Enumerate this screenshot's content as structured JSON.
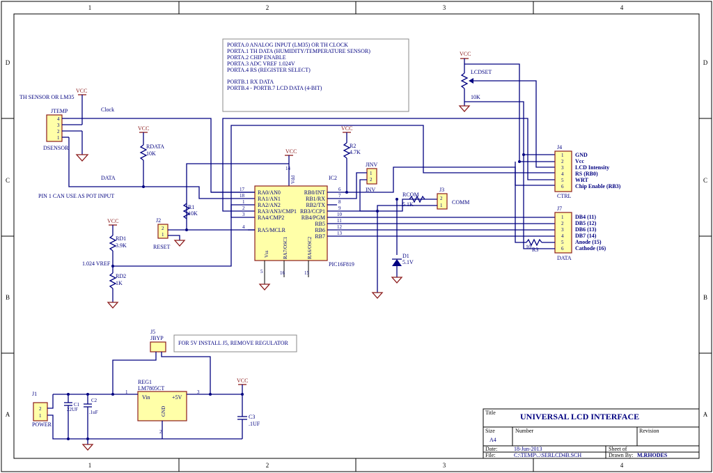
{
  "frame": {
    "columns": [
      "1",
      "2",
      "3",
      "4"
    ],
    "rows": [
      "D",
      "C",
      "B",
      "A"
    ]
  },
  "notes": {
    "porta": [
      "PORTA.0 ANALOG INPUT (LM35) OR TH CLOCK",
      "PORTA.1 TH DATA (HUMIDITY/TEMPERATURE SENSOR)",
      "PORTA.2 CHIP ENABLE",
      "PORTA.3 ADC VREF 1.024V",
      "PORTA.4 RS (REGISTER SELECT)"
    ],
    "portb": [
      "PORTB.1 RX DATA",
      "PORTB.4 - PORTB.7  LCD DATA (4-BIT)"
    ],
    "j5_note": "FOR 5V INSTALL J5, REMOVE REGULATOR",
    "pin1_note": "PIN 1 CAN USE AS POT INPUT"
  },
  "power_labels": {
    "vcc": "VCC"
  },
  "net_labels": {
    "clock": "Clock",
    "data": "DATA",
    "vref": "1.024 VREF"
  },
  "components": {
    "jtemp": {
      "ref": "JTEMP",
      "name": "DSENSOR",
      "header": "TH SENSOR OR LM35",
      "pins": [
        "4",
        "3",
        "2",
        "1"
      ]
    },
    "rdata": {
      "ref": "RDATA",
      "value": "10K"
    },
    "r1": {
      "ref": "R1",
      "value": "10K"
    },
    "r2": {
      "ref": "R2",
      "value": "4.7K"
    },
    "rd1": {
      "ref": "RD1",
      "value": "3.9K"
    },
    "rd2": {
      "ref": "RD2",
      "value": "1K"
    },
    "r3": {
      "ref": "R3",
      "value": "10"
    },
    "rcom": {
      "ref": "RCOM",
      "value": "5.1K"
    },
    "lcdset": {
      "ref": "LCDSET",
      "value": "10K"
    },
    "j2": {
      "ref": "J2",
      "name": "RESET",
      "pins": [
        "2",
        "1"
      ]
    },
    "jinv": {
      "ref": "JINV",
      "name": "INV",
      "pins": [
        "1",
        "2"
      ]
    },
    "j3": {
      "ref": "J3",
      "name": "COMM",
      "pins": [
        "2",
        "1"
      ]
    },
    "d1": {
      "ref": "D1",
      "value": "5.1V"
    },
    "j4": {
      "ref": "J4",
      "name": "CTRL",
      "pins": [
        "1",
        "2",
        "3",
        "4",
        "5",
        "6"
      ],
      "labels": [
        "GND",
        "Vcc",
        "LCD Intensity",
        "RS (RB0)",
        "WRT",
        "Chip Enable (RB3)"
      ]
    },
    "j7": {
      "ref": "J7",
      "name": "DATA",
      "pins": [
        "1",
        "2",
        "3",
        "4",
        "5",
        "6"
      ],
      "labels": [
        "DB4 (11)",
        "DB5 (12)",
        "DB6 (13)",
        "DB7 (14)",
        "Anode (15)",
        "Cathode (16)"
      ]
    },
    "ic2": {
      "ref": "IC2",
      "name": "PIC16F819",
      "left_pins": [
        "RA0/AN0",
        "RA1/AN1",
        "RA2/AN2",
        "RA3/AN3/CMP1",
        "RA4/CMP2",
        "RA5/MCLR"
      ],
      "left_nums": [
        "17",
        "18",
        "1",
        "2",
        "3",
        "4"
      ],
      "right_pins": [
        "RB0/INT",
        "RB1/RX",
        "RB2/TX",
        "RB3/CCP1",
        "RB4/PGM",
        "RB5",
        "RB6",
        "RB7"
      ],
      "right_nums": [
        "6",
        "7",
        "8",
        "9",
        "10",
        "11",
        "12",
        "13"
      ],
      "vdd": "Vdd",
      "vdd_num": "14",
      "vss": "Vss",
      "vss_num": "5",
      "osc1": "RA7/OSC1",
      "osc1_num": "16",
      "osc2": "RA6/OSC2",
      "osc2_num": "15"
    },
    "j5": {
      "ref": "J5",
      "name": "JBYP"
    },
    "reg1": {
      "ref": "REG1",
      "name": "LM7805CT",
      "vin": "Vin",
      "vout": "+5V",
      "gnd": "GND",
      "pin_in": "1",
      "pin_out": "3",
      "pin_gnd": "2"
    },
    "j1": {
      "ref": "J1",
      "name": "POWER",
      "pins": [
        "2",
        "1"
      ]
    },
    "c1": {
      "ref": "C1",
      "value": "22UF"
    },
    "c2": {
      "ref": "C2",
      "value": ".1uF"
    },
    "c3": {
      "ref": "C3",
      "value": ".1UF"
    }
  },
  "title_block": {
    "title_label": "Title",
    "title": "UNIVERSAL LCD INTERFACE",
    "size_label": "Size",
    "size": "A4",
    "number_label": "Number",
    "revision_label": "Revision",
    "date_label": "Date:",
    "date": "18-Jun-2013",
    "sheet_label": "Sheet    of",
    "file_label": "File:",
    "file": "C:\\TEMP\\..\\SERLCD4B.SCH",
    "drawn_label": "Drawn By:",
    "drawn": "M.RHODES"
  }
}
